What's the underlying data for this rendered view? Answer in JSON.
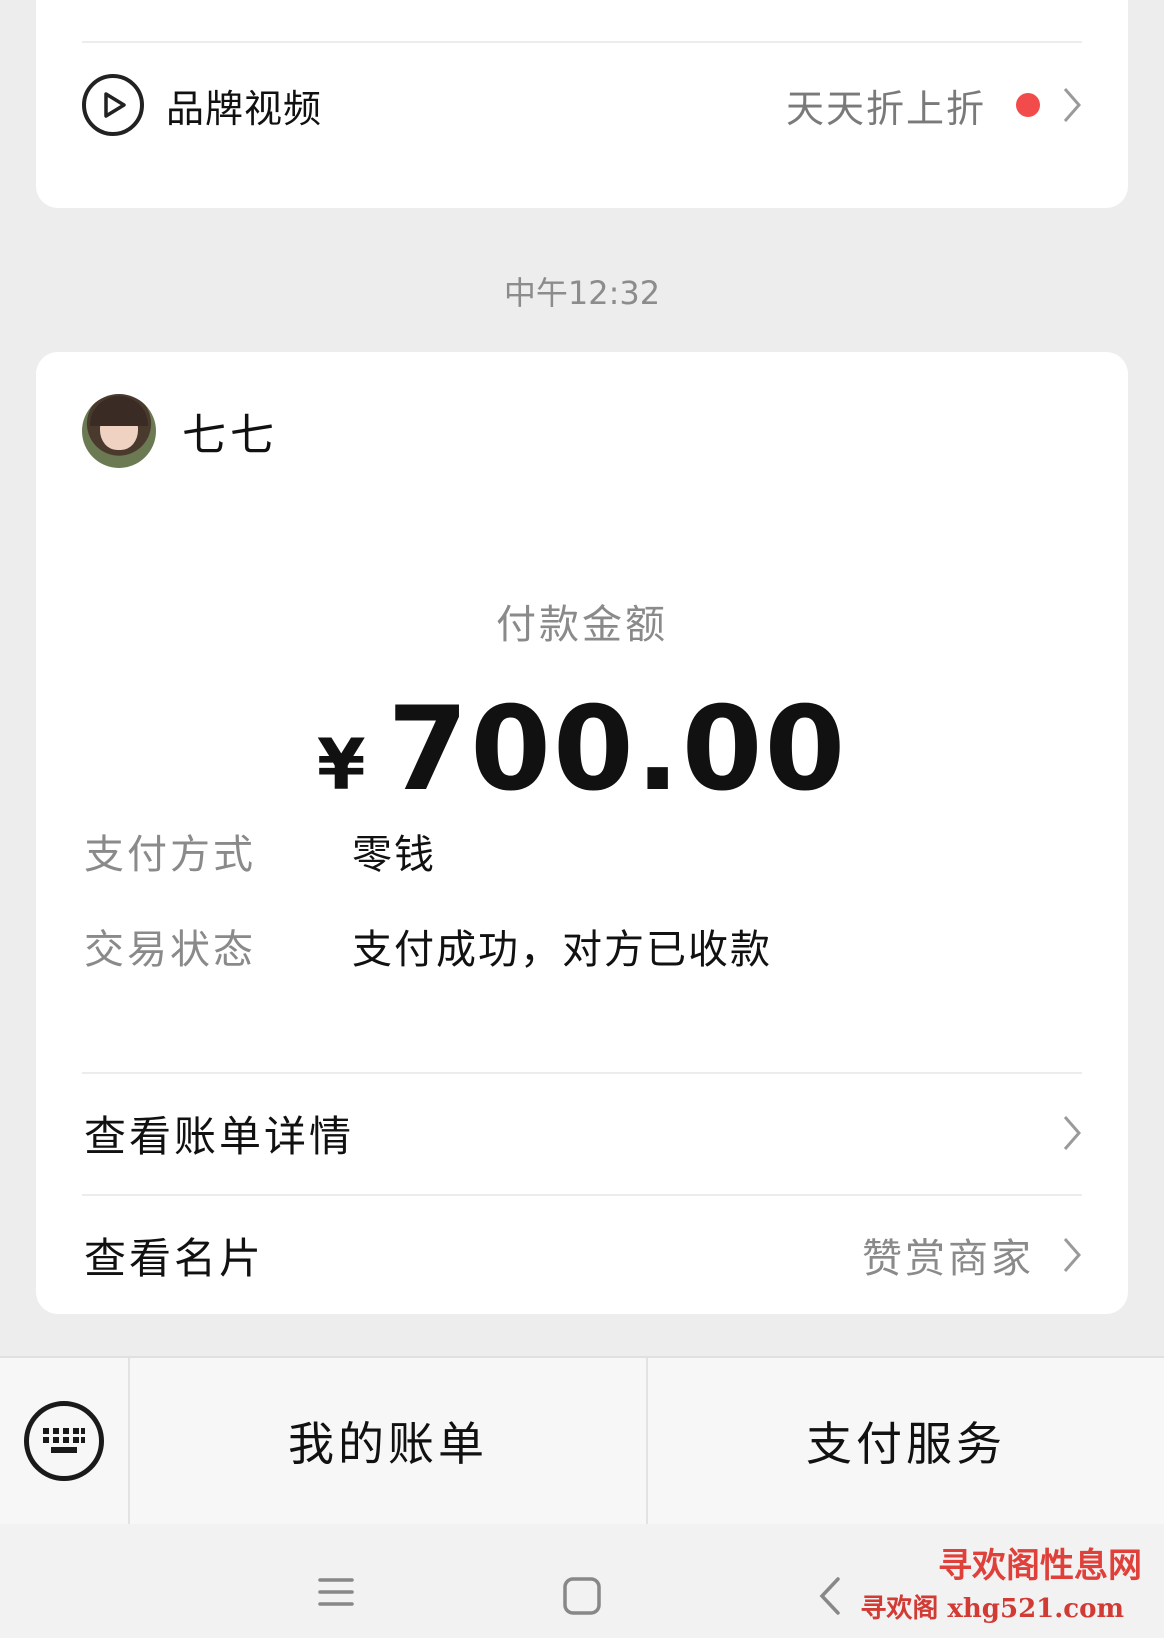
{
  "brand_card": {
    "label": "品牌视频",
    "sub_label": "天天折上折",
    "icon": "play-circle-icon",
    "badge_color": "#f24b4b"
  },
  "timestamp": "中午12:32",
  "payment": {
    "sender_name": "七七",
    "amount_label": "付款金额",
    "currency": "¥",
    "amount": "700.00",
    "details": [
      {
        "key": "支付方式",
        "value": "零钱"
      },
      {
        "key": "交易状态",
        "value": "支付成功，对方已收款"
      }
    ],
    "links": {
      "bill_details": "查看账单详情",
      "business_card": "查看名片",
      "business_card_sub": "赞赏商家"
    }
  },
  "bottom_bar": {
    "my_bill": "我的账单",
    "pay_service": "支付服务"
  },
  "watermark": {
    "line1": "寻欢阁性息网",
    "line2": "寻欢阁 xhg521.com"
  }
}
